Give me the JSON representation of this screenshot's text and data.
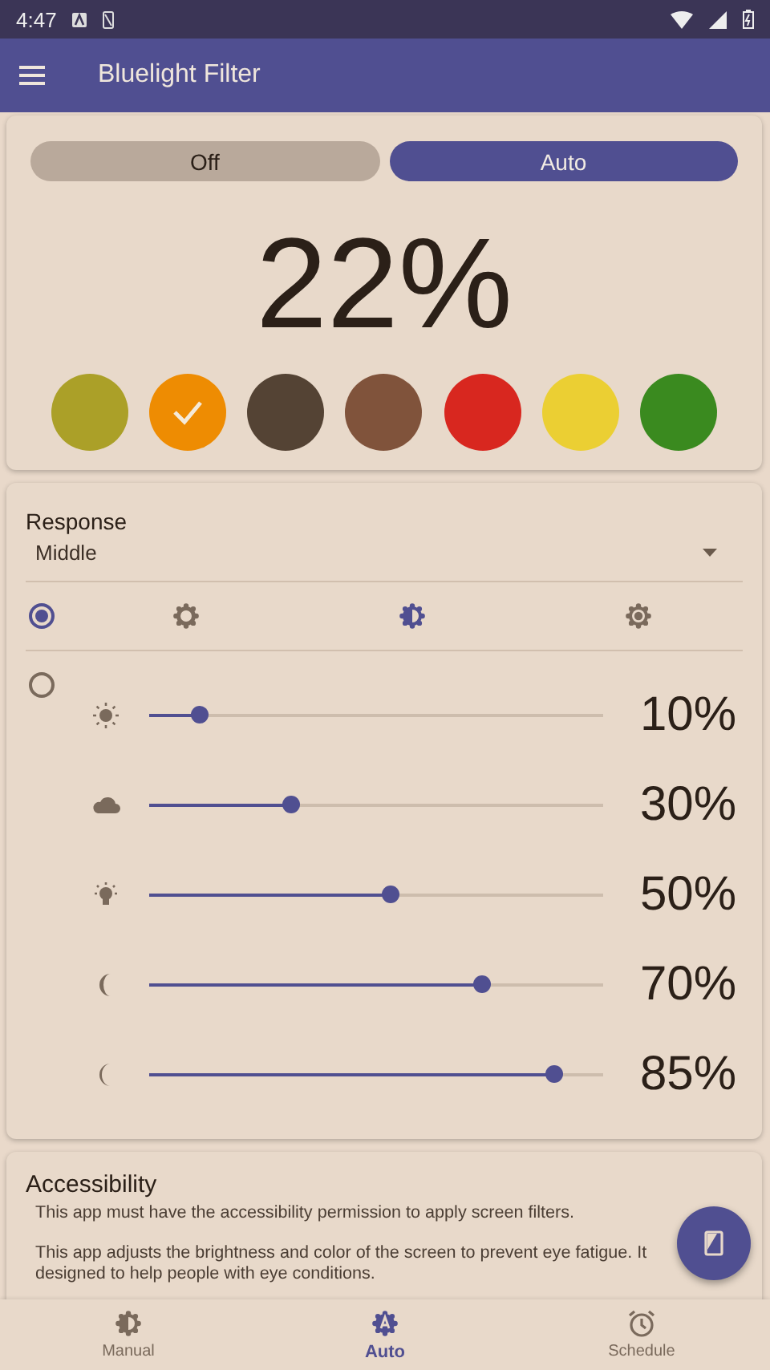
{
  "status_bar": {
    "time": "4:47"
  },
  "app_bar": {
    "title": "Bluelight Filter"
  },
  "mode_toggle": [
    {
      "label": "Off",
      "selected": false
    },
    {
      "label": "Auto",
      "selected": true
    }
  ],
  "intensity": "22%",
  "colors": [
    {
      "color": "#aba028",
      "selected": false
    },
    {
      "color": "#ee8c02",
      "selected": true
    },
    {
      "color": "#544334",
      "selected": false
    },
    {
      "color": "#80533b",
      "selected": false
    },
    {
      "color": "#d8271f",
      "selected": false
    },
    {
      "color": "#ebcf33",
      "selected": false
    },
    {
      "color": "#3a8a1f",
      "selected": false
    }
  ],
  "response": {
    "label": "Response",
    "value": "Middle"
  },
  "auto_options": {
    "selected": true,
    "modes": [
      {
        "kind": "low",
        "selected": false
      },
      {
        "kind": "contrast",
        "selected": true
      },
      {
        "kind": "high",
        "selected": false
      }
    ]
  },
  "manual_options": {
    "selected": false,
    "levels": [
      {
        "kind": "sun",
        "level": 0.11,
        "reading": "10%"
      },
      {
        "kind": "cloud",
        "level": 0.31,
        "reading": "30%"
      },
      {
        "kind": "bulb",
        "level": 0.53,
        "reading": "50%"
      },
      {
        "kind": "moon",
        "level": 0.73,
        "reading": "70%"
      },
      {
        "kind": "crescent",
        "level": 0.89,
        "reading": "85%"
      }
    ]
  },
  "accessibility": {
    "title": "Accessibility",
    "lines": [
      "This app must have the accessibility permission to apply screen filters.",
      "This app adjusts the brightness and color of the screen to prevent eye fatigue. It",
      "designed to help people with eye conditions."
    ]
  },
  "bottom_nav": [
    {
      "kind": "manual",
      "label": "Manual",
      "selected": false
    },
    {
      "kind": "auto",
      "label": "Auto",
      "selected": true
    },
    {
      "kind": "schedule",
      "label": "Schedule",
      "selected": false
    }
  ]
}
